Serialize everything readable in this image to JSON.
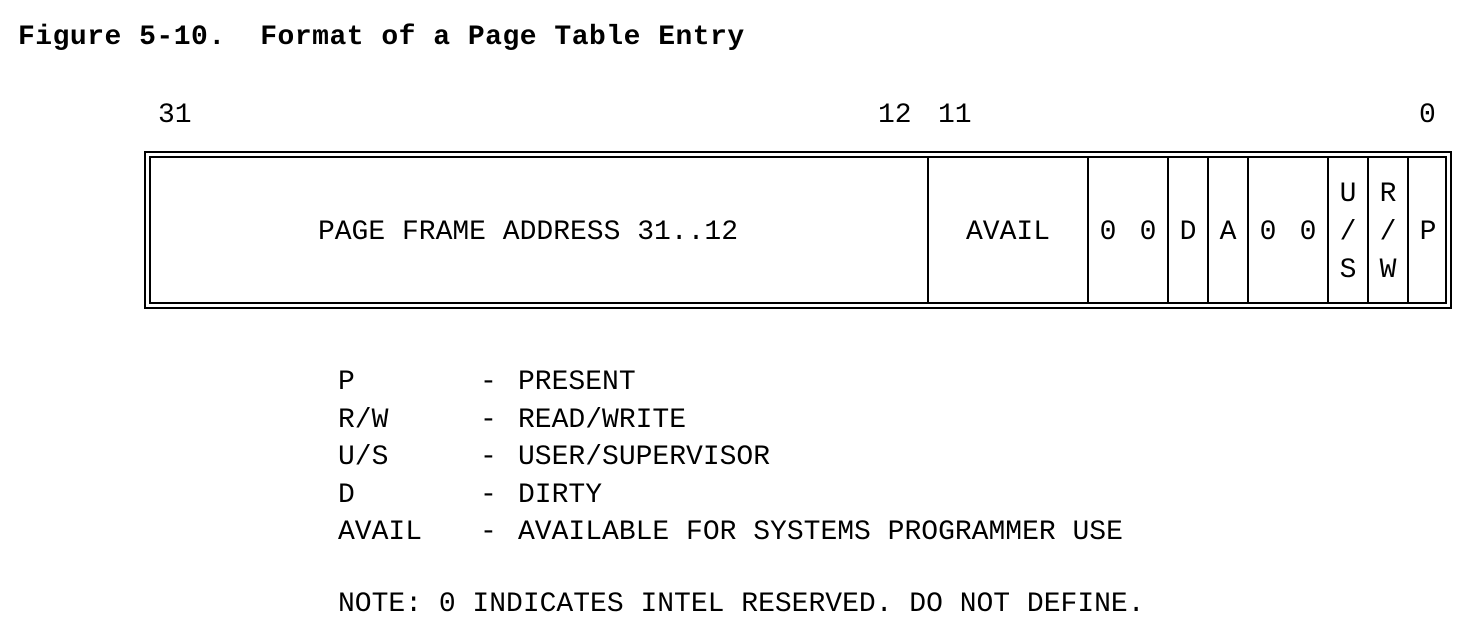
{
  "title": "Figure 5-10.  Format of a Page Table Entry",
  "bit_numbers": {
    "b31": "31",
    "b12": "12",
    "b11": "11",
    "b0": "0"
  },
  "fields": {
    "frame": "PAGE FRAME ADDRESS 31..12",
    "avail": "AVAIL",
    "zero_a": "0",
    "zero_b": "0",
    "d": "D",
    "a": "A",
    "zero_c": "0",
    "zero_d": "0",
    "us_top": "U",
    "us_mid": "/",
    "us_bot": "S",
    "rw_top": "R",
    "rw_mid": "/",
    "rw_bot": "W",
    "p": "P"
  },
  "legend": [
    {
      "abbr": "P",
      "dash": "-",
      "desc": "PRESENT"
    },
    {
      "abbr": "R/W",
      "dash": "-",
      "desc": "READ/WRITE"
    },
    {
      "abbr": "U/S",
      "dash": "-",
      "desc": "USER/SUPERVISOR"
    },
    {
      "abbr": "D",
      "dash": "-",
      "desc": "DIRTY"
    },
    {
      "abbr": "AVAIL",
      "dash": "-",
      "desc": "AVAILABLE FOR SYSTEMS PROGRAMMER USE"
    }
  ],
  "note": "NOTE: 0 INDICATES INTEL RESERVED. DO NOT DEFINE."
}
